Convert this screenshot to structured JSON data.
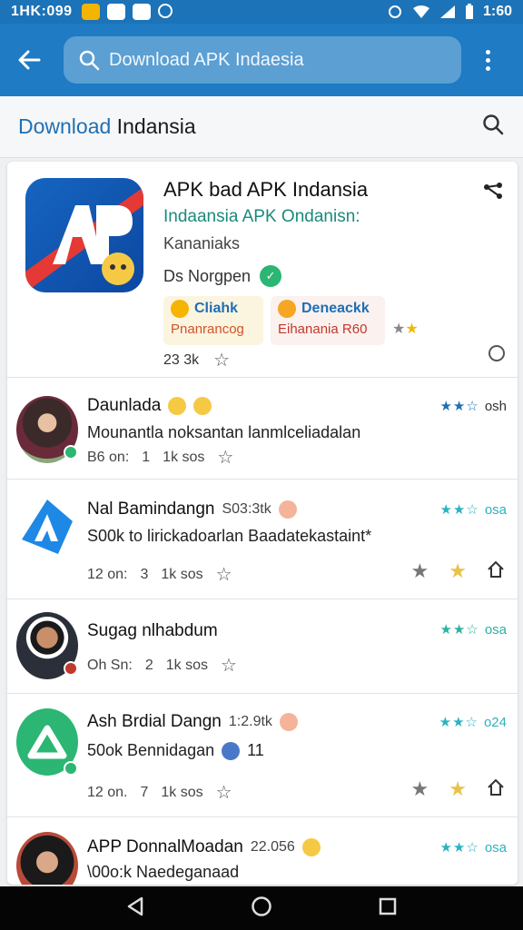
{
  "status_bar": {
    "time": "1HK:099",
    "clock": "1:60"
  },
  "search": {
    "query": "Download APK Indaesia"
  },
  "section": {
    "title_highlight": "Download",
    "title_rest": " Indansia"
  },
  "featured": {
    "title": "APK bad APK Indansia",
    "subtitle": "Indaansia  APK Ondanisn:",
    "category": "Kananiaks",
    "developer": "Ds Norgpen",
    "verified_mark": "✓",
    "chip1": {
      "top": "Cliahk",
      "bottom": "Pnanrancog"
    },
    "chip2": {
      "top": "Deneackk",
      "bottom": "Eihanania R60"
    },
    "meta": "23 3k"
  },
  "rows": [
    {
      "title": "Daunlada",
      "num": "",
      "desc": "Mounantla noksantan lanmlceliadalan",
      "meta_left": "B6 on:",
      "meta_num": "1",
      "meta_unit": "1k sos",
      "rate_label": "osh",
      "star_color": "#1f6fb5"
    },
    {
      "title": "Nal Bamindangn",
      "num": "S03:3tk",
      "desc": "S00k to lirickadoarlan Baadatekastaint*",
      "meta_left": "12 on:",
      "meta_num": "3",
      "meta_unit": "1k sos",
      "rate_label": "osa",
      "star_color": "#2bb3c0"
    },
    {
      "title": "Sugag nlhabdum",
      "num": "",
      "desc": "",
      "meta_left": "Oh Sn:",
      "meta_num": "2",
      "meta_unit": "1k sos",
      "rate_label": "osa",
      "star_color": "#2bb3a0"
    },
    {
      "title": "Ash Brdial Dangn",
      "num": "1:2.9tk",
      "desc": "50ok Bennidagan",
      "desc_num": "11",
      "meta_left": "12 on.",
      "meta_num": "7",
      "meta_unit": "1k sos",
      "rate_label": "o24",
      "star_color": "#2bb3c0"
    },
    {
      "title": "APP DonnalMoadan",
      "num": "22.056",
      "desc": "\\00o:k Naedeganaad",
      "meta_left": "",
      "meta_num": "",
      "meta_unit": "",
      "rate_label": "osa",
      "star_color": "#2bb3c0"
    }
  ],
  "stars_glyph": "★★☆",
  "colors": {
    "status_bar": "#1c73b8",
    "app_bar": "#1e7bc4",
    "accent": "#1f6fb5",
    "teal": "#1a8a7a"
  }
}
